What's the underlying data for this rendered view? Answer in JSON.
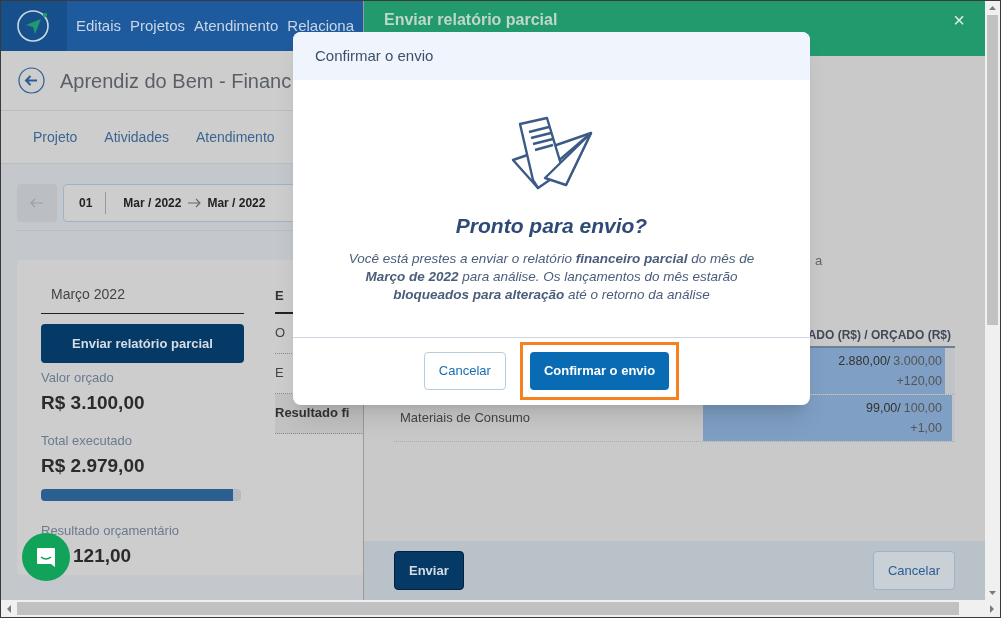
{
  "nav": {
    "items": [
      "Editais",
      "Projetos",
      "Atendimento",
      "Relaciona"
    ]
  },
  "page": {
    "title": "Aprendiz do Bem - Financ",
    "tabs": [
      {
        "label": "Projeto"
      },
      {
        "label": "Atividades"
      },
      {
        "label": "Atendimento"
      }
    ],
    "pager": {
      "number": "01",
      "from": "Mar / 2022",
      "to": "Mar / 2022"
    },
    "summary": {
      "month": "Março 2022",
      "send_button": "Enviar relatório parcial",
      "budget_label": "Valor orçado",
      "budget_value": "R$ 3.100,00",
      "executed_label": "Total executado",
      "executed_value": "R$ 2.979,00",
      "level": 0.96,
      "result_label": "Resultado orçamentário",
      "result_value": "121,00"
    },
    "side_table": {
      "header": "E",
      "rows": [
        {
          "label": "O",
          "kind": "plain"
        },
        {
          "label": "E",
          "kind": "plain"
        },
        {
          "label": "Resultado fi",
          "kind": "total"
        }
      ]
    }
  },
  "drawer": {
    "title": "Enviar relatório parcial",
    "close": "×",
    "text_fragment": "a",
    "table": {
      "header": "ADO (R$) / ORÇADO (R$)",
      "rows": [
        {
          "label": "",
          "value": "2.880,00/",
          "budget": "3.000,00",
          "diff": "+120,00",
          "level": 0.96
        },
        {
          "label": "Materiais de Consumo",
          "value": "99,00/",
          "budget": "100,00",
          "diff": "+1,00",
          "level": 0.99
        }
      ]
    },
    "buttons": [
      {
        "label": "Enviar",
        "kind": "primary"
      },
      {
        "label": "Cancelar",
        "kind": "secondary"
      }
    ]
  },
  "modal": {
    "title": "Confirmar o envio",
    "heading": "Pronto para envio?",
    "message": "Você está prestes a enviar o relatório **financeiro parcial** do mês de **Março de 2022** para análise. Os lançamentos do mês estarão **bloqueados para alteração** até o retorno da análise",
    "buttons": [
      {
        "label": "Cancelar",
        "kind": "secondary",
        "highlighted": false
      },
      {
        "label": "Confirmar o envio",
        "kind": "primary",
        "highlighted": true
      }
    ]
  }
}
